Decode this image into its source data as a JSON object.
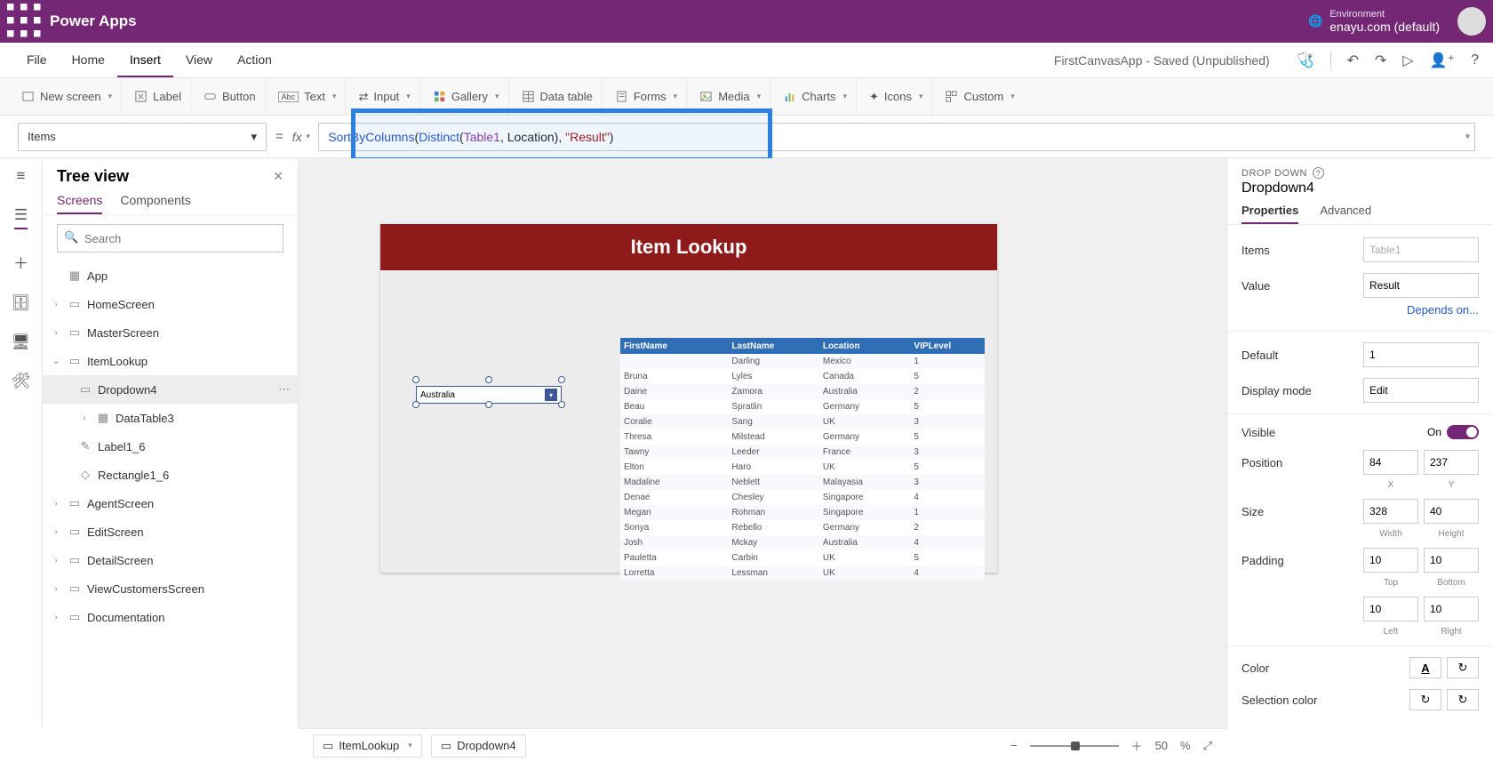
{
  "titlebar": {
    "app_name": "Power Apps",
    "env_label": "Environment",
    "env_value": "enayu.com (default)"
  },
  "menubar": {
    "file": "File",
    "home": "Home",
    "insert": "Insert",
    "view": "View",
    "action": "Action",
    "doc_title": "FirstCanvasApp - Saved (Unpublished)"
  },
  "ribbon": {
    "new_screen": "New screen",
    "label": "Label",
    "button": "Button",
    "text": "Text",
    "input": "Input",
    "gallery": "Gallery",
    "data_table": "Data table",
    "forms": "Forms",
    "media": "Media",
    "charts": "Charts",
    "icons": "Icons",
    "custom": "Custom"
  },
  "formula": {
    "property": "Items",
    "equals": "=",
    "fx": "fx",
    "expr_tokens": [
      {
        "t": "fn",
        "v": "SortByColumns"
      },
      {
        "t": "pl",
        "v": "("
      },
      {
        "t": "fn",
        "v": "Distinct"
      },
      {
        "t": "pl",
        "v": "("
      },
      {
        "t": "id",
        "v": "Table1"
      },
      {
        "t": "pl",
        "v": ", Location), "
      },
      {
        "t": "str",
        "v": "\"Result\""
      },
      {
        "t": "pl",
        "v": ")"
      }
    ]
  },
  "tree": {
    "title": "Tree view",
    "tab_screens": "Screens",
    "tab_components": "Components",
    "search_placeholder": "Search",
    "app": "App",
    "screens": {
      "home": "HomeScreen",
      "master": "MasterScreen",
      "itemlookup": "ItemLookup",
      "dropdown4": "Dropdown4",
      "datatable3": "DataTable3",
      "label16": "Label1_6",
      "rect16": "Rectangle1_6",
      "agent": "AgentScreen",
      "edit": "EditScreen",
      "detail": "DetailScreen",
      "viewcust": "ViewCustomersScreen",
      "doc": "Documentation"
    }
  },
  "canvas": {
    "header_title": "Item Lookup",
    "dropdown_value": "Australia",
    "table": {
      "headers": [
        "FirstName",
        "LastName",
        "Location",
        "VIPLevel"
      ],
      "rows": [
        [
          "",
          "Darling",
          "Mexico",
          "1"
        ],
        [
          "Bruna",
          "Lyles",
          "Canada",
          "5"
        ],
        [
          "Daine",
          "Zamora",
          "Australia",
          "2"
        ],
        [
          "Beau",
          "Spratlin",
          "Germany",
          "5"
        ],
        [
          "Coralie",
          "Sang",
          "UK",
          "3"
        ],
        [
          "Thresa",
          "Milstead",
          "Germany",
          "5"
        ],
        [
          "Tawny",
          "Leeder",
          "France",
          "3"
        ],
        [
          "Elton",
          "Haro",
          "UK",
          "5"
        ],
        [
          "Madaline",
          "Neblett",
          "Malayasia",
          "3"
        ],
        [
          "Denae",
          "Chesley",
          "Singapore",
          "4"
        ],
        [
          "Megan",
          "Rohman",
          "Singapore",
          "1"
        ],
        [
          "Sonya",
          "Rebello",
          "Germany",
          "2"
        ],
        [
          "Josh",
          "Mckay",
          "Australia",
          "4"
        ],
        [
          "Pauletta",
          "Carbin",
          "UK",
          "5"
        ],
        [
          "Lorretta",
          "Lessman",
          "UK",
          "4"
        ]
      ]
    }
  },
  "props": {
    "type_label": "DROP DOWN",
    "control_name": "Dropdown4",
    "tab_properties": "Properties",
    "tab_advanced": "Advanced",
    "items_label": "Items",
    "items_value": "Table1",
    "value_label": "Value",
    "value_value": "Result",
    "depends_link": "Depends on...",
    "default_label": "Default",
    "default_value": "1",
    "displaymode_label": "Display mode",
    "displaymode_value": "Edit",
    "visible_label": "Visible",
    "visible_value": "On",
    "position_label": "Position",
    "pos_x": "84",
    "pos_y": "237",
    "pos_x_lbl": "X",
    "pos_y_lbl": "Y",
    "size_label": "Size",
    "size_w": "328",
    "size_h": "40",
    "size_w_lbl": "Width",
    "size_h_lbl": "Height",
    "padding_label": "Padding",
    "pad_t": "10",
    "pad_b": "10",
    "pad_l": "10",
    "pad_r": "10",
    "pad_t_lbl": "Top",
    "pad_b_lbl": "Bottom",
    "pad_l_lbl": "Left",
    "pad_r_lbl": "Right",
    "color_label": "Color",
    "selcolor_label": "Selection color"
  },
  "footer": {
    "crumb1": "ItemLookup",
    "crumb2": "Dropdown4",
    "zoom_value": "50",
    "zoom_pct": "%"
  }
}
